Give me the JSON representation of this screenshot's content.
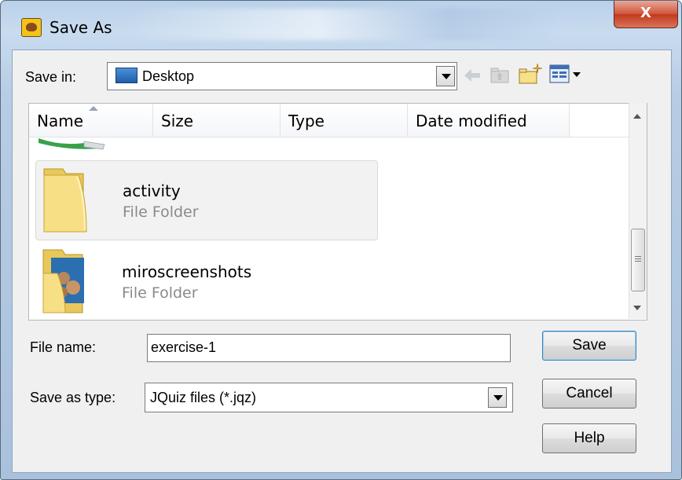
{
  "window": {
    "title": "Save As",
    "close_label": "X"
  },
  "toolbar": {
    "save_in_label": "Save in:",
    "save_in_value": "Desktop",
    "icons": [
      "back-arrow-icon",
      "up-folder-icon",
      "new-folder-icon",
      "view-menu-icon"
    ]
  },
  "list": {
    "columns": [
      "Name",
      "Size",
      "Type",
      "Date modified"
    ],
    "items": [
      {
        "name": "activity",
        "type": "File Folder",
        "selected": true
      },
      {
        "name": "miroscreenshots",
        "type": "File Folder",
        "selected": false
      }
    ]
  },
  "form": {
    "file_name_label": "File name:",
    "file_name_value": "exercise-1",
    "save_as_type_label": "Save as type:",
    "save_as_type_value": "JQuiz files (*.jqz)"
  },
  "buttons": {
    "save": "Save",
    "cancel": "Cancel",
    "help": "Help"
  },
  "colors": {
    "title_bar": "#b9d1ea",
    "close_button": "#c23a1e",
    "default_button_border": "#3c7fb1"
  }
}
